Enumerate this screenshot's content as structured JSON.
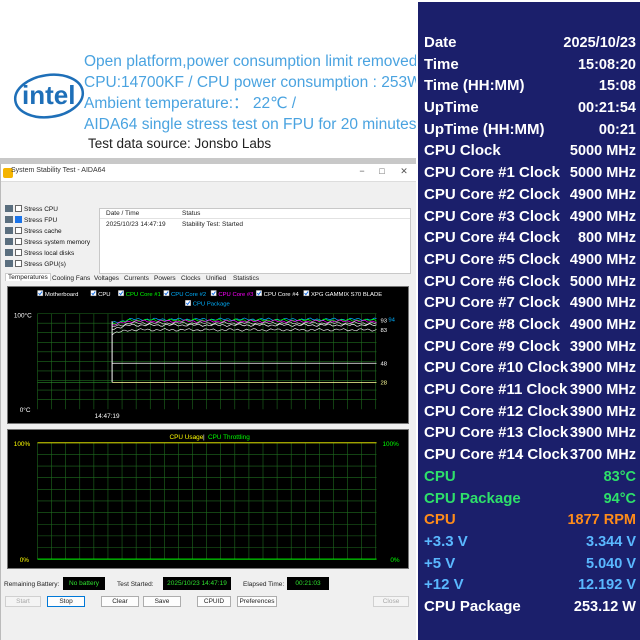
{
  "header": {
    "lines": [
      "Open platform,power consumption limit removed",
      "CPU:14700KF / CPU power consumption : 253W",
      "Ambient temperature:： 22℃ /",
      "AIDA64 single stress test on FPU for 20 minutes"
    ],
    "source": "Test data source: Jonsbo Labs",
    "text_color": "#4aa3e0",
    "logo": {
      "icon": "intel-logo-icon",
      "text": "intel",
      "color": "#1e6fb8"
    }
  },
  "window": {
    "title": "System Stability Test - AIDA64",
    "controls": {
      "minimize": "−",
      "maximize": "□",
      "close": "✕"
    },
    "stress_options": [
      {
        "label": "Stress CPU",
        "checked": false,
        "icon": "cpu-icon"
      },
      {
        "label": "Stress FPU",
        "checked": true,
        "icon": "fpu-icon"
      },
      {
        "label": "Stress cache",
        "checked": false,
        "icon": "cache-icon"
      },
      {
        "label": "Stress system memory",
        "checked": false,
        "icon": "memory-icon"
      },
      {
        "label": "Stress local disks",
        "checked": false,
        "icon": "disk-icon"
      },
      {
        "label": "Stress GPU(s)",
        "checked": false,
        "icon": "gpu-icon"
      }
    ],
    "log": {
      "headers": [
        "Date / Time",
        "Status"
      ],
      "rows": [
        {
          "datetime": "2025/10/23 14:47:19",
          "status": "Stability Test: Started"
        }
      ]
    },
    "tabs": [
      "Temperatures",
      "Cooling Fans",
      "Voltages",
      "Currents",
      "Powers",
      "Clocks",
      "Unified",
      "Statistics"
    ],
    "active_tab": "Temperatures",
    "temp_graph": {
      "legend": [
        {
          "label": "Motherboard",
          "color": "#ffffff"
        },
        {
          "label": "CPU",
          "color": "#ffffff"
        },
        {
          "label": "CPU Core #1",
          "color": "#00ff00"
        },
        {
          "label": "CPU Core #2",
          "color": "#00b0ff"
        },
        {
          "label": "CPU Core #3",
          "color": "#ff00ff"
        },
        {
          "label": "CPU Core #4",
          "color": "#ffffff"
        },
        {
          "label": "XPG GAMMIX S70 BLADE",
          "color": "#ffffff"
        },
        {
          "label": "CPU Package",
          "color": "#00b0ff"
        }
      ],
      "y_top_label": "100°C",
      "y_bottom_label": "0°C",
      "x_label": "14:47:19",
      "right_labels": [
        "93",
        "94",
        "83",
        "48",
        "28"
      ],
      "ylim": [
        0,
        100
      ],
      "levels": [
        {
          "name": "CPU Package",
          "value": 94,
          "color": "#00b0ff"
        },
        {
          "name": "CPU Core",
          "value": 93,
          "color": "#00ff00"
        },
        {
          "name": "CPU Core #3",
          "value": 92,
          "color": "#ff00ff"
        },
        {
          "name": "CPU",
          "value": 90,
          "color": "#d0d0d0"
        },
        {
          "name": "CPU Core #4",
          "value": 88,
          "color": "#ffffff"
        },
        {
          "name": "Level 83",
          "value": 83,
          "color": "#e8e8e8"
        },
        {
          "name": "Level 48",
          "value": 48,
          "color": "#ffffff"
        },
        {
          "name": "Level 28",
          "value": 28,
          "color": "#ffff99"
        }
      ],
      "start_fraction": 0.22,
      "pre_start_value": 28
    },
    "usage_graph": {
      "title_usage": "CPU Usage",
      "title_sep": "|",
      "title_throttle": "CPU Throttling",
      "usage_color": "#ffff00",
      "throttle_color": "#00ff00",
      "left_top_label": "100%",
      "left_bottom_label": "0%",
      "right_top_label": "100%",
      "right_bottom_label": "0%"
    },
    "status": {
      "battery_label": "Remaining Battery:",
      "battery_value": "No battery",
      "started_label": "Test Started:",
      "started_value": "2025/10/23 14:47:19",
      "elapsed_label": "Elapsed Time:",
      "elapsed_value": "00:21:03"
    },
    "buttons": {
      "start": "Start",
      "stop": "Stop",
      "clear": "Clear",
      "save": "Save",
      "cpuid": "CPUID",
      "preferences": "Preferences",
      "close": "Close"
    }
  },
  "stats": [
    {
      "label": "Date",
      "value": "2025/10/23",
      "color": "#ffffff"
    },
    {
      "label": "Time",
      "value": "15:08:20",
      "color": "#ffffff"
    },
    {
      "label": "Time (HH:MM)",
      "value": "15:08",
      "color": "#ffffff"
    },
    {
      "label": "UpTime",
      "value": "00:21:54",
      "color": "#ffffff"
    },
    {
      "label": "UpTime (HH:MM)",
      "value": "00:21",
      "color": "#ffffff"
    },
    {
      "label": "CPU Clock",
      "value": "5000 MHz",
      "color": "#ffffff"
    },
    {
      "label": "CPU Core #1 Clock",
      "value": "5000 MHz",
      "color": "#ffffff"
    },
    {
      "label": "CPU Core #2 Clock",
      "value": "4900 MHz",
      "color": "#ffffff"
    },
    {
      "label": "CPU Core #3 Clock",
      "value": "4900 MHz",
      "color": "#ffffff"
    },
    {
      "label": "CPU Core #4 Clock",
      "value": "800 MHz",
      "color": "#ffffff"
    },
    {
      "label": "CPU Core #5 Clock",
      "value": "4900 MHz",
      "color": "#ffffff"
    },
    {
      "label": "CPU Core #6 Clock",
      "value": "5000 MHz",
      "color": "#ffffff"
    },
    {
      "label": "CPU Core #7 Clock",
      "value": "4900 MHz",
      "color": "#ffffff"
    },
    {
      "label": "CPU Core #8 Clock",
      "value": "4900 MHz",
      "color": "#ffffff"
    },
    {
      "label": "CPU Core #9 Clock",
      "value": "3900 MHz",
      "color": "#ffffff"
    },
    {
      "label": "CPU Core #10 Clock",
      "value": "3900 MHz",
      "color": "#ffffff"
    },
    {
      "label": "CPU Core #11 Clock",
      "value": "3900 MHz",
      "color": "#ffffff"
    },
    {
      "label": "CPU Core #12 Clock",
      "value": "3900 MHz",
      "color": "#ffffff"
    },
    {
      "label": "CPU Core #13 Clock",
      "value": "3900 MHz",
      "color": "#ffffff"
    },
    {
      "label": "CPU Core #14 Clock",
      "value": "3700 MHz",
      "color": "#ffffff"
    },
    {
      "label": "CPU",
      "value": "83°C",
      "color": "#2ee06a"
    },
    {
      "label": "CPU Package",
      "value": "94°C",
      "color": "#2ee06a"
    },
    {
      "label": "CPU",
      "value": "1877 RPM",
      "color": "#ff8c1a"
    },
    {
      "label": "+3.3 V",
      "value": "3.344 V",
      "color": "#5ab8ff"
    },
    {
      "label": "+5 V",
      "value": "5.040 V",
      "color": "#5ab8ff"
    },
    {
      "label": "+12 V",
      "value": "12.192 V",
      "color": "#5ab8ff"
    },
    {
      "label": "CPU Package",
      "value": "253.12 W",
      "color": "#ffffff"
    }
  ],
  "colors": {
    "panel_bg": "#1b1f6b",
    "graph_bg": "#000000",
    "grid": "#1f6b1f"
  }
}
